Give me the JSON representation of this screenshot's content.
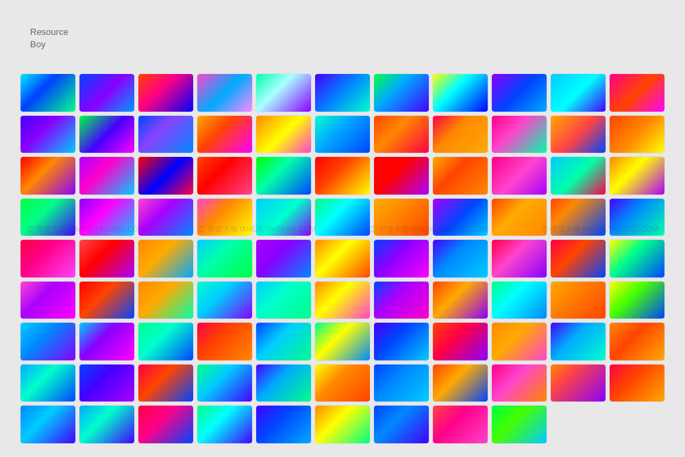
{
  "title": {
    "line1": "Resource",
    "line2": "Boy"
  },
  "watermark": {
    "texts": [
      "② 早道大咖 IAMDK.TAOBAO.COM",
      "② 早道大咖 IAMDK.TAOBAO.COM",
      "② 早道大咖 IAMDK.TAOBAO.COM",
      "② 早道大咖 IAMDK.TAOBAO.COM"
    ]
  },
  "gradients": [
    "linear-gradient(135deg, #00eaff 0%, #0040ff 40%, #00ff88 100%)",
    "linear-gradient(135deg, #0044ff 0%, #8800ff 50%, #0099ff 100%)",
    "linear-gradient(135deg, #ff4400 0%, #ff0080 40%, #0000ff 100%)",
    "linear-gradient(135deg, #ff44cc 0%, #00aaff 50%, #ff88ff 100%)",
    "linear-gradient(135deg, #00ffaa 0%, #aaffff 40%, #8800ff 100%)",
    "linear-gradient(135deg, #4400ff 0%, #0088ff 50%, #00ffcc 100%)",
    "linear-gradient(135deg, #00ff44 0%, #00aaff 40%, #4400ff 100%)",
    "linear-gradient(135deg, #ffff00 0%, #00ffff 40%, #0000ff 100%)",
    "linear-gradient(135deg, #8800ff 0%, #0044ff 50%, #00aaff 100%)",
    "linear-gradient(135deg, #00ccff 0%, #00ffff 50%, #4400ff 100%)",
    "linear-gradient(135deg, #ff0088 0%, #ff4400 50%, #ff00ff 100%)",
    "linear-gradient(135deg, #4400ff 0%, #8800ff 40%, #00ccff 100%)",
    "linear-gradient(135deg, #00ff44 0%, #4400ff 50%, #ff00ff 100%)",
    "linear-gradient(135deg, #0044ff 0%, #8844ff 40%, #0088ff 100%)",
    "linear-gradient(135deg, #ffaa00 0%, #ff4400 40%, #ff00ff 100%)",
    "linear-gradient(135deg, #ff8800 0%, #ffff00 50%, #ff44cc 100%)",
    "linear-gradient(135deg, #00ffcc 0%, #00aaff 40%, #0044ff 100%)",
    "linear-gradient(135deg, #ff4400 0%, #ff8800 40%, #ff0044 100%)",
    "linear-gradient(135deg, #ff0044 0%, #ff8800 40%, #ffaa00 100%)",
    "linear-gradient(135deg, #ff0088 0%, #ff44cc 40%, #00ffaa 100%)",
    "linear-gradient(135deg, #ffaa00 0%, #ff4444 50%, #0044ff 100%)",
    "linear-gradient(135deg, #ff4400 0%, #ff8800 50%, #ffff00 100%)",
    "linear-gradient(135deg, #ff0000 0%, #ff8800 40%, #8800ff 100%)",
    "linear-gradient(135deg, #aa00ff 0%, #ff00cc 40%, #00ccff 100%)",
    "linear-gradient(135deg, #ff0000 0%, #0000ff 50%, #ff0044 100%)",
    "linear-gradient(135deg, #ff4400 0%, #ff0000 40%, #ff4488 100%)",
    "linear-gradient(135deg, #00ff00 0%, #00ffaa 40%, #0044ff 100%)",
    "linear-gradient(135deg, #ff0000 0%, #ff4400 40%, #ffff00 100%)",
    "linear-gradient(135deg, #ff0000 0%, #ff0000 40%, #aa00ff 100%)",
    "linear-gradient(135deg, #ffaa00 0%, #ff4400 40%, #ff8800 100%)",
    "linear-gradient(135deg, #ff0088 0%, #ff44cc 50%, #aa00ff 100%)",
    "linear-gradient(135deg, #00ccff 0%, #00ffaa 50%, #ff0044 100%)",
    "linear-gradient(135deg, #ff8800 0%, #ffff00 40%, #aa00ff 100%)",
    "linear-gradient(135deg, #00ff44 0%, #00ff88 40%, #4400ff 100%)",
    "linear-gradient(135deg, #8800ff 0%, #ff00ff 40%, #00ccff 100%)",
    "linear-gradient(135deg, #ff44cc 0%, #aa00ff 40%, #0088ff 100%)",
    "linear-gradient(135deg, #ff44cc 0%, #ff8800 40%, #ffff00 100%)",
    "linear-gradient(135deg, #00ccff 0%, #00ffcc 50%, #8800ff 100%)",
    "linear-gradient(135deg, #00ff88 0%, #00ffff 40%, #0044ff 100%)",
    "linear-gradient(135deg, #ffaa00 0%, #ff8800 40%, #ff4400 100%)",
    "linear-gradient(135deg, #aa00ff 0%, #0044ff 50%, #00ccff 100%)",
    "linear-gradient(135deg, #ff4400 0%, #ffaa00 40%, #ff8800 100%)",
    "linear-gradient(135deg, #ff4400 0%, #ff8800 30%, #0044ff 100%)",
    "linear-gradient(135deg, #4400ff 0%, #0088ff 40%, #00ffaa 100%)",
    "linear-gradient(135deg, #ff0044 0%, #ff0088 40%, #ff44ff 100%)",
    "linear-gradient(135deg, #ff4444 0%, #ff0000 40%, #aa00ff 100%)",
    "linear-gradient(135deg, #ff8800 0%, #ffaa00 40%, #00aaff 100%)",
    "linear-gradient(135deg, #00ccff 0%, #00ffaa 40%, #00ff44 100%)",
    "linear-gradient(135deg, #aa00ff 0%, #8800ff 40%, #0088ff 100%)",
    "linear-gradient(135deg, #ff8800 0%, #ffff00 40%, #ff4400 100%)",
    "linear-gradient(135deg, #0044ff 0%, #8800ff 40%, #ff00ff 100%)",
    "linear-gradient(135deg, #4400ff 0%, #0088ff 40%, #00ccff 100%)",
    "linear-gradient(135deg, #ff0044 0%, #ff44cc 40%, #8800ff 100%)",
    "linear-gradient(135deg, #ff0044 0%, #ff4400 40%, #0044ff 100%)",
    "linear-gradient(135deg, #ffff00 0%, #00ff88 40%, #0044ff 100%)",
    "linear-gradient(135deg, #ff44cc 0%, #aa00ff 40%, #ff00ff 100%)",
    "linear-gradient(135deg, #ff0000 0%, #ff4400 40%, #0044ff 100%)",
    "linear-gradient(135deg, #ff8800 0%, #ffaa00 40%, #00ffaa 100%)",
    "linear-gradient(135deg, #00ffcc 0%, #00ccff 40%, #8800ff 100%)",
    "linear-gradient(135deg, #00ccff 0%, #00ffcc 40%, #00ff88 100%)",
    "linear-gradient(135deg, #ff8800 0%, #ffff00 40%, #ff44cc 100%)",
    "linear-gradient(135deg, #0044ff 0%, #aa00ff 40%, #ff00cc 100%)",
    "linear-gradient(135deg, #ff4400 0%, #ffaa00 40%, #8800ff 100%)",
    "linear-gradient(135deg, #00ff88 0%, #00ffff 40%, #0088ff 100%)",
    "linear-gradient(135deg, #ffaa00 0%, #ff8800 30%, #ff4400 100%)",
    "linear-gradient(135deg, #ffff00 0%, #44ff00 40%, #0044ff 100%)",
    "linear-gradient(135deg, #00ccff 0%, #0088ff 40%, #8800ff 100%)",
    "linear-gradient(135deg, #00ccff 0%, #8800ff 40%, #ff00ff 100%)",
    "linear-gradient(135deg, #00ff88 0%, #00ffcc 40%, #0044ff 100%)",
    "linear-gradient(135deg, #ff0044 0%, #ff4400 40%, #ff8800 100%)",
    "linear-gradient(135deg, #0044ff 0%, #00ccff 40%, #00ff88 100%)",
    "linear-gradient(135deg, #00ff88 0%, #ffff00 40%, #0088ff 100%)",
    "linear-gradient(135deg, #4400ff 0%, #0044ff 40%, #00ccff 100%)",
    "linear-gradient(135deg, #ff4400 0%, #ff0044 40%, #8800ff 100%)",
    "linear-gradient(135deg, #ff8800 0%, #ffaa00 40%, #ff44cc 100%)",
    "linear-gradient(135deg, #4400ff 0%, #00aaff 40%, #00ffcc 100%)",
    "linear-gradient(135deg, #ff8800 0%, #ff4400 40%, #ffaa00 100%)",
    "linear-gradient(135deg, #00aaff 0%, #00ffcc 40%, #0044ff 100%)",
    "linear-gradient(135deg, #0044ff 0%, #4400ff 40%, #aa00ff 100%)",
    "linear-gradient(135deg, #ff0044 0%, #ff4400 40%, #0044ff 100%)",
    "linear-gradient(135deg, #00ff88 0%, #00ccff 40%, #4400ff 100%)",
    "linear-gradient(135deg, #4400ff 0%, #00aaff 40%, #00ff88 100%)",
    "linear-gradient(135deg, #ffff00 0%, #ff8800 40%, #ff4400 100%)",
    "linear-gradient(135deg, #0044ff 0%, #0088ff 40%, #00ccff 100%)",
    "linear-gradient(135deg, #ff4400 0%, #ffaa00 40%, #0044ff 100%)",
    "linear-gradient(135deg, #ff0088 0%, #ff44cc 40%, #ff8800 100%)",
    "linear-gradient(135deg, #ff8800 0%, #ff4444 30%, #8800ff 100%)",
    "linear-gradient(135deg, #ff0044 0%, #ff4400 40%, #ffaa00 100%)",
    "linear-gradient(135deg, #0088ff 0%, #00ccff 40%, #4400ff 100%)",
    "linear-gradient(135deg, #00aaff 0%, #00ffcc 40%, #4400ff 100%)",
    "linear-gradient(135deg, #ff0044 0%, #ff0088 40%, #0044ff 100%)",
    "linear-gradient(135deg, #00ff88 0%, #00ffff 40%, #4400ff 100%)",
    "linear-gradient(135deg, #4400ff 0%, #0044ff 40%, #00aaff 100%)",
    "linear-gradient(135deg, #ff8800 0%, #ffff00 40%, #00ff88 100%)",
    "linear-gradient(135deg, #0044ff 0%, #0088ff 40%, #4400ff 100%)",
    "linear-gradient(135deg, #ff4444 0%, #ff0088 40%, #ff44cc 100%)",
    "linear-gradient(135deg, #00ff44 0%, #44ff00 40%, #00ccff 100%)"
  ]
}
